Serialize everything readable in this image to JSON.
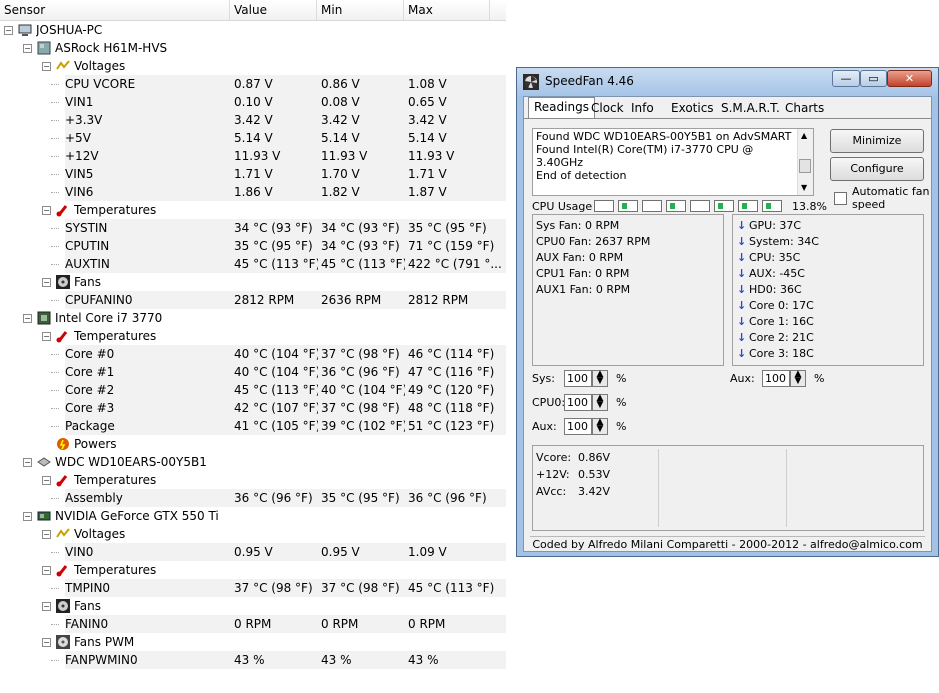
{
  "hwmonitor": {
    "columns": [
      "Sensor",
      "Value",
      "Min",
      "Max"
    ],
    "rows": [
      {
        "level": 0,
        "type": "computer",
        "icon": "computer-icon",
        "label": "JOSHUA-PC"
      },
      {
        "level": 1,
        "type": "board",
        "icon": "motherboard-icon",
        "label": "ASRock H61M-HVS"
      },
      {
        "level": 2,
        "type": "group",
        "icon": "voltage-icon",
        "label": "Voltages"
      },
      {
        "level": 3,
        "type": "leaf",
        "label": "CPU VCORE",
        "value": "0.87 V",
        "min": "0.86 V",
        "max": "1.08 V"
      },
      {
        "level": 3,
        "type": "leaf",
        "label": "VIN1",
        "value": "0.10 V",
        "min": "0.08 V",
        "max": "0.65 V"
      },
      {
        "level": 3,
        "type": "leaf",
        "label": "+3.3V",
        "value": "3.42 V",
        "min": "3.42 V",
        "max": "3.42 V"
      },
      {
        "level": 3,
        "type": "leaf",
        "label": "+5V",
        "value": "5.14 V",
        "min": "5.14 V",
        "max": "5.14 V"
      },
      {
        "level": 3,
        "type": "leaf",
        "label": "+12V",
        "value": "11.93 V",
        "min": "11.93 V",
        "max": "11.93 V"
      },
      {
        "level": 3,
        "type": "leaf",
        "label": "VIN5",
        "value": "1.71 V",
        "min": "1.70 V",
        "max": "1.71 V"
      },
      {
        "level": 3,
        "type": "leaf",
        "label": "VIN6",
        "value": "1.86 V",
        "min": "1.82 V",
        "max": "1.87 V"
      },
      {
        "level": 2,
        "type": "group",
        "icon": "thermometer-icon",
        "label": "Temperatures"
      },
      {
        "level": 3,
        "type": "leaf",
        "label": "SYSTIN",
        "value": "34 °C  (93 °F)",
        "min": "34 °C  (93 °F)",
        "max": "35 °C  (95 °F)"
      },
      {
        "level": 3,
        "type": "leaf",
        "label": "CPUTIN",
        "value": "35 °C  (95 °F)",
        "min": "34 °C  (93 °F)",
        "max": "71 °C  (159 °F)"
      },
      {
        "level": 3,
        "type": "leaf",
        "label": "AUXTIN",
        "value": "45 °C  (113 °F)",
        "min": "45 °C  (113 °F)",
        "max": "422 °C  (791 °..."
      },
      {
        "level": 2,
        "type": "group",
        "icon": "fan-icon",
        "label": "Fans"
      },
      {
        "level": 3,
        "type": "leaf",
        "label": "CPUFANIN0",
        "value": "2812 RPM",
        "min": "2636 RPM",
        "max": "2812 RPM"
      },
      {
        "level": 1,
        "type": "board",
        "icon": "cpu-chip-icon",
        "label": "Intel Core i7 3770"
      },
      {
        "level": 2,
        "type": "group",
        "icon": "thermometer-icon",
        "label": "Temperatures"
      },
      {
        "level": 3,
        "type": "leaf",
        "label": "Core #0",
        "value": "40 °C  (104 °F)",
        "min": "37 °C  (98 °F)",
        "max": "46 °C  (114 °F)"
      },
      {
        "level": 3,
        "type": "leaf",
        "label": "Core #1",
        "value": "40 °C  (104 °F)",
        "min": "36 °C  (96 °F)",
        "max": "47 °C  (116 °F)"
      },
      {
        "level": 3,
        "type": "leaf",
        "label": "Core #2",
        "value": "45 °C  (113 °F)",
        "min": "40 °C  (104 °F)",
        "max": "49 °C  (120 °F)"
      },
      {
        "level": 3,
        "type": "leaf",
        "label": "Core #3",
        "value": "42 °C  (107 °F)",
        "min": "37 °C  (98 °F)",
        "max": "48 °C  (118 °F)"
      },
      {
        "level": 3,
        "type": "leaf",
        "label": "Package",
        "value": "41 °C  (105 °F)",
        "min": "39 °C  (102 °F)",
        "max": "51 °C  (123 °F)"
      },
      {
        "level": 2,
        "type": "group",
        "icon": "power-icon",
        "label": "Powers",
        "noexp": true
      },
      {
        "level": 1,
        "type": "board",
        "icon": "hard-drive-icon",
        "label": "WDC WD10EARS-00Y5B1"
      },
      {
        "level": 2,
        "type": "group",
        "icon": "thermometer-icon",
        "label": "Temperatures"
      },
      {
        "level": 3,
        "type": "leaf",
        "label": "Assembly",
        "value": "36 °C  (96 °F)",
        "min": "35 °C  (95 °F)",
        "max": "36 °C  (96 °F)"
      },
      {
        "level": 1,
        "type": "board",
        "icon": "graphics-card-icon",
        "label": "NVIDIA GeForce GTX 550 Ti"
      },
      {
        "level": 2,
        "type": "group",
        "icon": "voltage-icon",
        "label": "Voltages"
      },
      {
        "level": 3,
        "type": "leaf",
        "label": "VIN0",
        "value": "0.95 V",
        "min": "0.95 V",
        "max": "1.09 V"
      },
      {
        "level": 2,
        "type": "group",
        "icon": "thermometer-icon",
        "label": "Temperatures"
      },
      {
        "level": 3,
        "type": "leaf",
        "label": "TMPIN0",
        "value": "37 °C  (98 °F)",
        "min": "37 °C  (98 °F)",
        "max": "45 °C  (113 °F)"
      },
      {
        "level": 2,
        "type": "group",
        "icon": "fan-icon",
        "label": "Fans"
      },
      {
        "level": 3,
        "type": "leaf",
        "label": "FANIN0",
        "value": "0 RPM",
        "min": "0 RPM",
        "max": "0 RPM"
      },
      {
        "level": 2,
        "type": "group",
        "icon": "fan-pwm-icon",
        "label": "Fans PWM"
      },
      {
        "level": 3,
        "type": "leaf",
        "label": "FANPWMIN0",
        "value": "43 %",
        "min": "43 %",
        "max": "43 %"
      }
    ]
  },
  "speedfan": {
    "title": "SpeedFan 4.46",
    "window_buttons": {
      "minimize": "—",
      "maximize": "▭",
      "close": "✕"
    },
    "tabs": [
      "Readings",
      "Clock",
      "Info",
      "Exotics",
      "S.M.A.R.T.",
      "Charts"
    ],
    "active_tab": "Readings",
    "log": [
      "Found WDC WD10EARS-00Y5B1 on AdvSMART",
      "Found Intel(R) Core(TM) i7-3770 CPU @ 3.40GHz",
      "End of detection"
    ],
    "buttons": {
      "minimize": "Minimize",
      "configure": "Configure"
    },
    "auto_fan_label": "Automatic fan speed",
    "auto_fan_checked": false,
    "cpu_usage": {
      "label": "CPU Usage",
      "percent": "13.8%",
      "bars": [
        0,
        1,
        0,
        1,
        0,
        1,
        1,
        1
      ]
    },
    "fans": [
      {
        "name": "Sys Fan:",
        "value": "0 RPM"
      },
      {
        "name": "CPU0 Fan:",
        "value": "2637 RPM"
      },
      {
        "name": "AUX Fan:",
        "value": "0 RPM"
      },
      {
        "name": "CPU1 Fan:",
        "value": "0 RPM"
      },
      {
        "name": "AUX1 Fan:",
        "value": "0 RPM"
      }
    ],
    "temps": [
      {
        "name": "GPU:",
        "value": "37C"
      },
      {
        "name": "System:",
        "value": "34C"
      },
      {
        "name": "CPU:",
        "value": "35C"
      },
      {
        "name": "AUX:",
        "value": "-45C"
      },
      {
        "name": "HD0:",
        "value": "36C"
      },
      {
        "name": "Core 0:",
        "value": "17C"
      },
      {
        "name": "Core 1:",
        "value": "16C"
      },
      {
        "name": "Core 2:",
        "value": "21C"
      },
      {
        "name": "Core 3:",
        "value": "18C"
      }
    ],
    "speeds": [
      {
        "name": "Sys:",
        "value": "100",
        "unit": "%"
      },
      {
        "name": "CPU0:",
        "value": "100",
        "unit": "%"
      },
      {
        "name": "Aux:",
        "value": "100",
        "unit": "%"
      },
      {
        "name": "Aux:",
        "value": "100",
        "unit": "%"
      }
    ],
    "voltages": [
      {
        "name": "Vcore:",
        "value": "0.86V"
      },
      {
        "name": "+12V:",
        "value": "0.53V"
      },
      {
        "name": "AVcc:",
        "value": "3.42V"
      }
    ],
    "footer": "Coded by Alfredo Milani Comparetti - 2000-2012 - alfredo@almico.com"
  }
}
